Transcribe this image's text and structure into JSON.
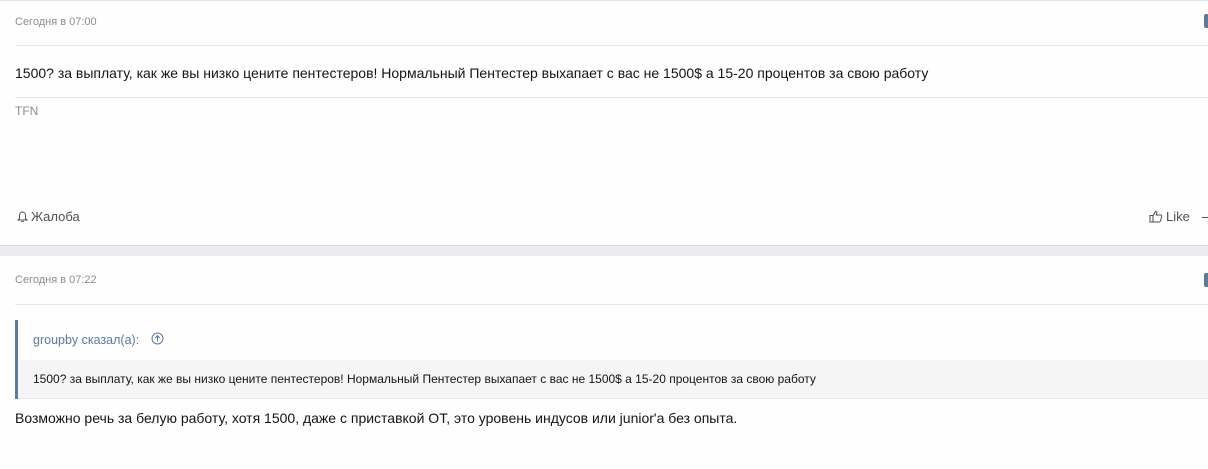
{
  "posts": [
    {
      "date": "Сегодня в 07:00",
      "text": "1500? за выплату, как же вы низко цените пентестеров! Нормальный Пентестер выхапает с вас не 1500$ а 15-20 процентов за свою работу",
      "signature": "TFN",
      "report_label": "Жалоба",
      "like_label": "Like"
    },
    {
      "date": "Сегодня в 07:22",
      "quote": {
        "author": "groupby сказал(а):",
        "text": "1500? за выплату, как же вы низко цените пентестеров! Нормальный Пентестер выхапает с вас не 1500$ а 15-20 процентов за свою работу"
      },
      "text": "Возможно речь за белую работу, хотя 1500, даже с приставкой ОТ, это уровень индусов или junior'а без опыта."
    }
  ],
  "colors": {
    "accent": "#5a7b9c",
    "muted": "#8c8c8c",
    "background": "#ebecee"
  },
  "icons": {
    "report": "bell-icon",
    "like": "thumbs-up-icon",
    "quote_jump": "arrow-up-circle-icon"
  }
}
